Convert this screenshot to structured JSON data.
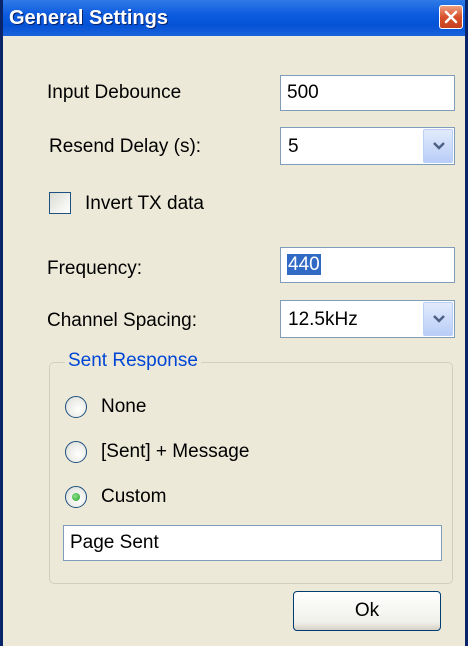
{
  "window": {
    "title": "General Settings"
  },
  "fields": {
    "input_debounce": {
      "label": "Input Debounce",
      "value": "500"
    },
    "resend_delay": {
      "label": "Resend Delay (s):",
      "value": "5"
    },
    "invert_tx": {
      "label": "Invert TX data",
      "checked": false
    },
    "frequency": {
      "label": "Frequency:",
      "value": "440"
    },
    "channel_spacing": {
      "label": "Channel Spacing:",
      "value": "12.5kHz"
    }
  },
  "sent_response": {
    "legend": "Sent Response",
    "options": [
      {
        "label": "None",
        "selected": false
      },
      {
        "label": "[Sent] + Message",
        "selected": false
      },
      {
        "label": "Custom",
        "selected": true
      }
    ],
    "custom_text": "Page Sent"
  },
  "buttons": {
    "ok_label": "Ok"
  },
  "icons": {
    "close": "close-icon",
    "dropdown": "chevron-down-icon"
  },
  "colors": {
    "titlebar": "#0552d6",
    "window_bg": "#ece9d8",
    "legend": "#0046d5",
    "selection": "#316ac5"
  }
}
